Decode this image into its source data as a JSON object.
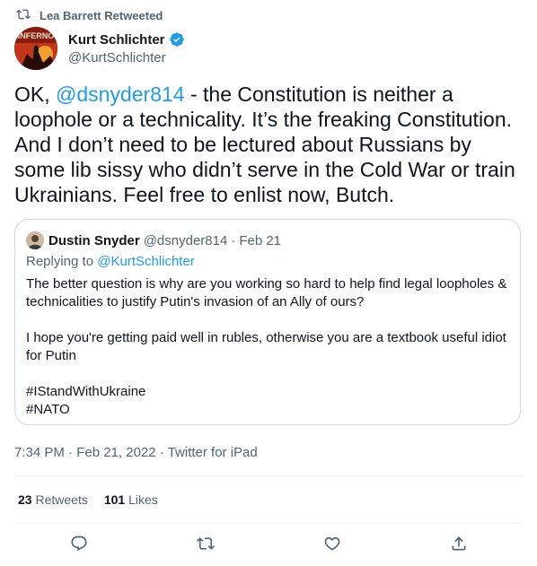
{
  "retweet": {
    "label": "Lea Barrett Retweeted",
    "icon": "retweet-icon"
  },
  "author": {
    "display_name": "Kurt Schlichter",
    "handle": "@KurtSchlichter",
    "verified": true,
    "avatar_text": "INFERNO"
  },
  "tweet": {
    "prefix": "OK, ",
    "mention": "@dsnyder814",
    "body": " - the Constitution is neither a loophole or a technicality. It’s the freaking Constitution. And I don’t need to be lectured about Russians by some lib sissy who didn’t serve in the Cold War or train Ukrainians. Feel free to enlist now, Butch."
  },
  "quoted": {
    "display_name": "Dustin Snyder",
    "handle": "@dsnyder814",
    "separator": "·",
    "date": "Feb 21",
    "replying_prefix": "Replying to ",
    "replying_to": "@KurtSchlichter",
    "paragraph1": "The better question is why are you working so hard to help find legal loopholes & technicalities to justify Putin's invasion of an Ally of ours?",
    "paragraph2": "I hope you're getting paid well in rubles, otherwise you are a textbook useful idiot for Putin",
    "hashtag1": "#IStandWithUkraine",
    "hashtag2": "#NATO"
  },
  "meta": {
    "time": "7:34 PM",
    "date": "Feb 21, 2022",
    "source": "Twitter for iPad",
    "separator": "·"
  },
  "stats": {
    "retweets_count": "23",
    "retweets_label": "Retweets",
    "likes_count": "101",
    "likes_label": "Likes"
  },
  "actions": [
    "reply-icon",
    "retweet-icon",
    "like-icon",
    "share-icon"
  ],
  "colors": {
    "accent": "#1d9bf0",
    "secondary_text": "#536471",
    "primary_text": "#0f1419",
    "border": "#cfd9de"
  }
}
